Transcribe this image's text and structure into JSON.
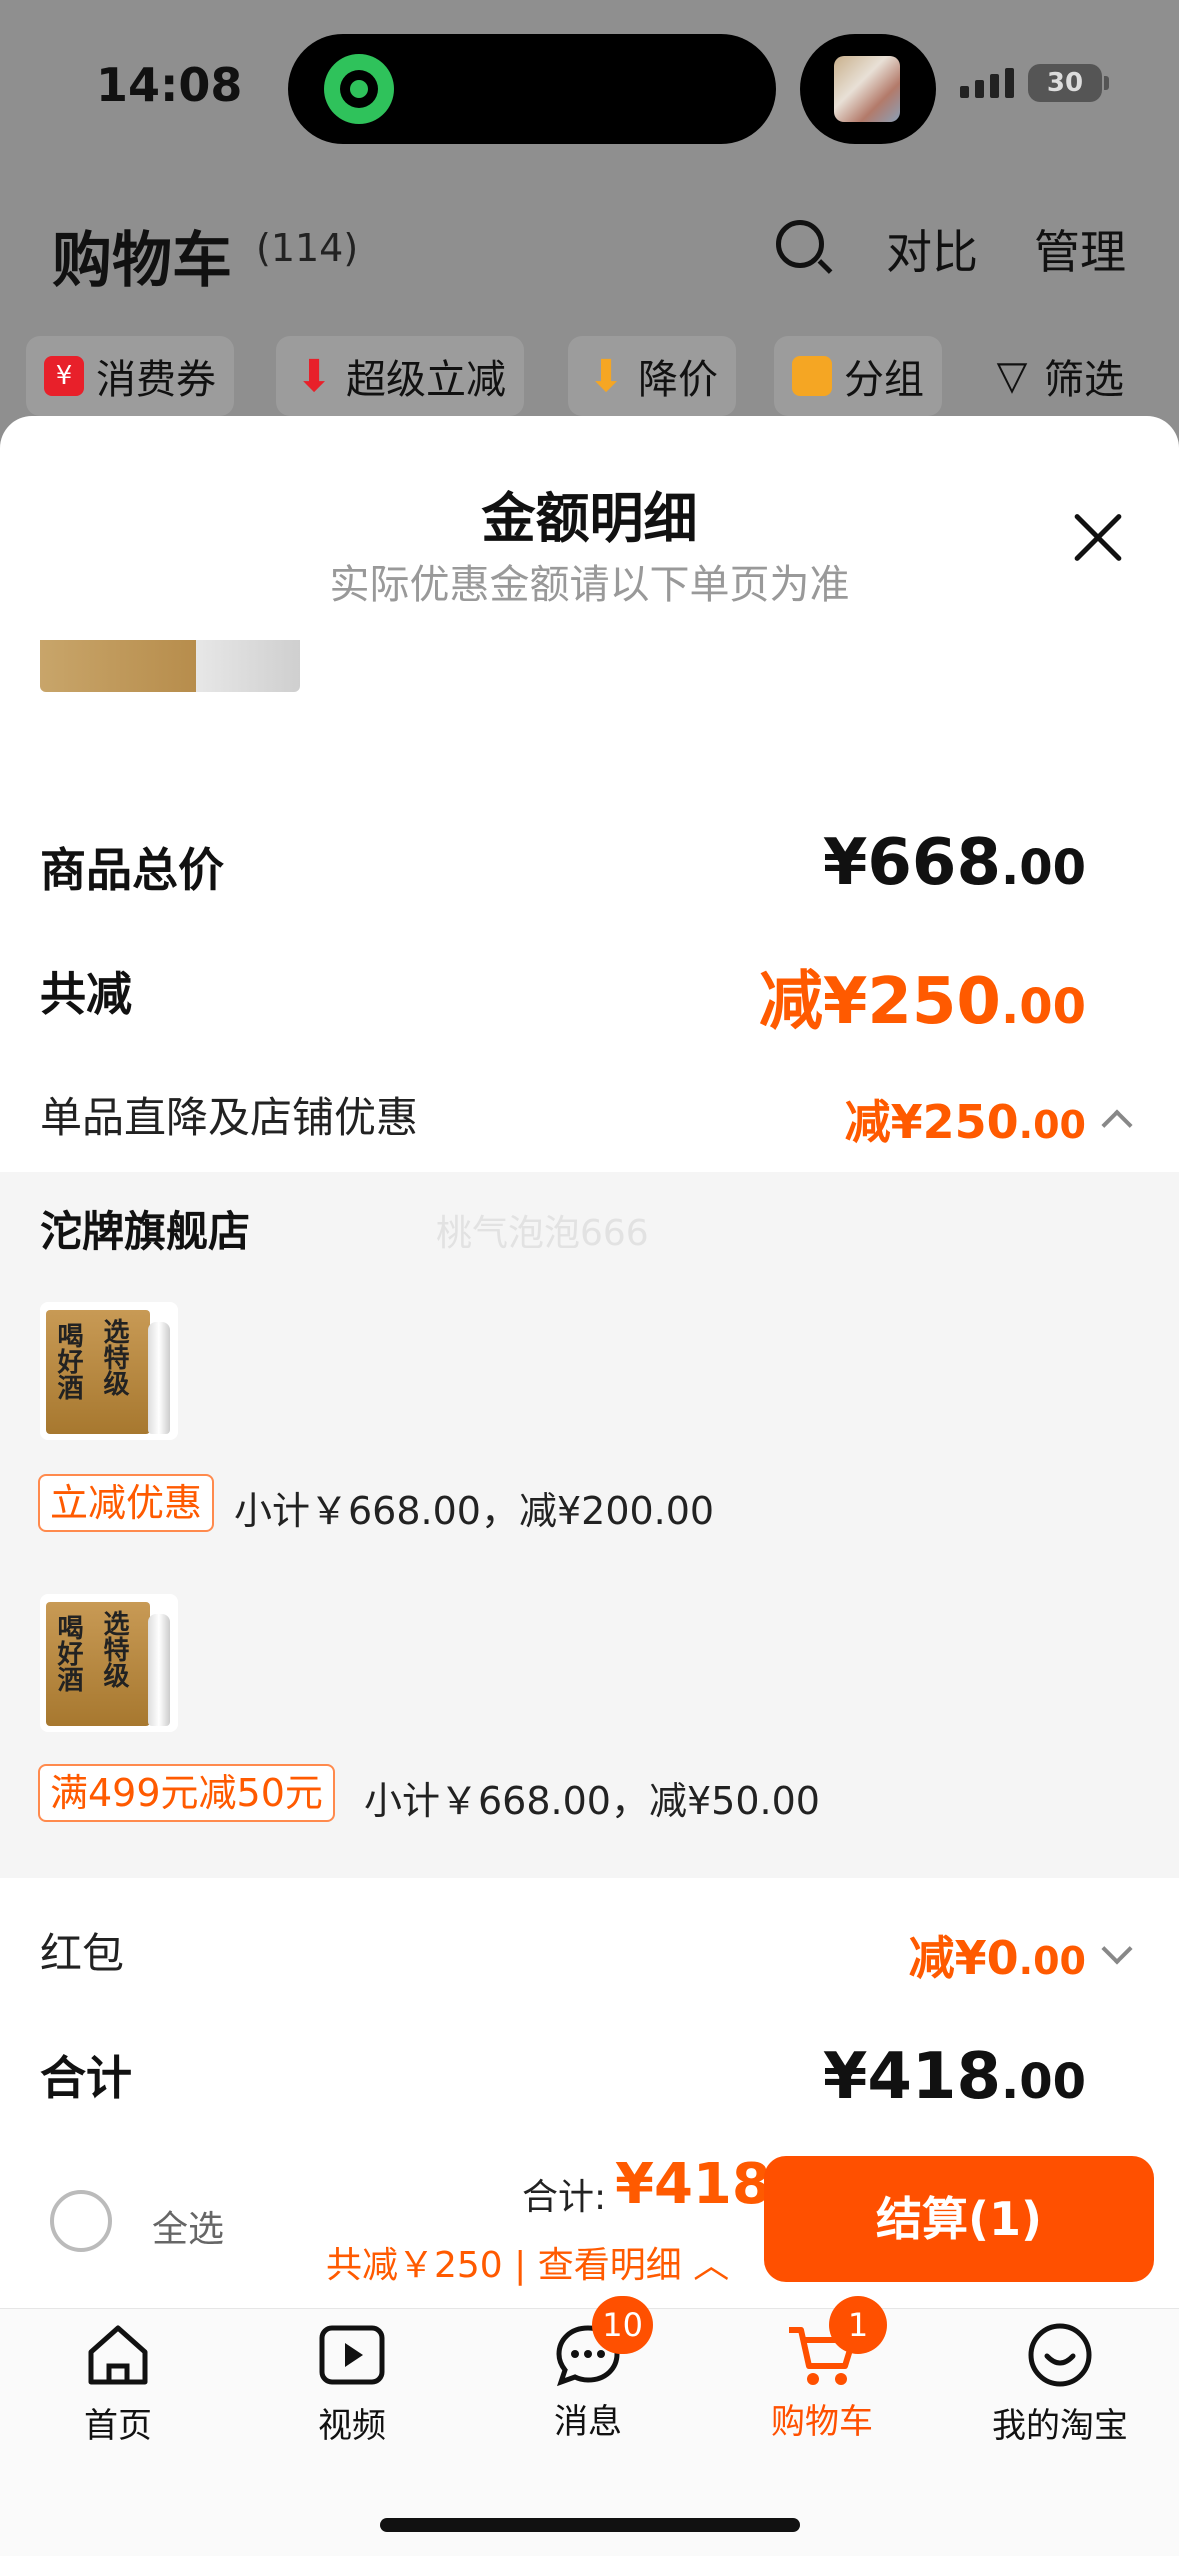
{
  "status_bar": {
    "time": "14:08",
    "battery": "30"
  },
  "header": {
    "title": "购物车",
    "count": "(114)",
    "compare": "对比",
    "manage": "管理"
  },
  "filters": [
    {
      "label": "消费券",
      "icon": "coupon-icon",
      "color": "#e8202a"
    },
    {
      "label": "超级立减",
      "icon": "arrow-down-icon",
      "color": "#e8202a"
    },
    {
      "label": "降价",
      "icon": "price-drop-icon",
      "color": "#f5a623"
    },
    {
      "label": "分组",
      "icon": "folder-icon",
      "color": "#f5a623"
    },
    {
      "label": "筛选",
      "icon": "filter-icon",
      "color": "#111111"
    }
  ],
  "sheet": {
    "title": "金额明细",
    "subtitle": "实际优惠金额请以下单页为准",
    "product_total_label": "商品总价",
    "product_total_value": "¥668",
    "product_total_cents": ".00",
    "total_reduce_label": "共减",
    "total_reduce_value": "减¥250",
    "total_reduce_cents": ".00",
    "item_discount_label": "单品直降及店铺优惠",
    "item_discount_value": "减¥250",
    "item_discount_cents": ".00",
    "store_name": "沱牌旗舰店",
    "watermark": "桃气泡泡666",
    "items": [
      {
        "tag": "立减优惠",
        "subtotal": "小计￥668.00，减¥200.00",
        "box_text_a": "喝好酒",
        "box_text_b": "选特级"
      },
      {
        "tag": "满499元减50元",
        "subtotal": "小计￥668.00，减¥50.00",
        "box_text_a": "喝好酒",
        "box_text_b": "选特级"
      }
    ],
    "red_packet_label": "红包",
    "red_packet_value": "减¥0",
    "red_packet_cents": ".00",
    "sum_label": "合计",
    "sum_value": "¥418",
    "sum_cents": ".00"
  },
  "bottom_bar": {
    "select_all": "全选",
    "total_label": "合计:",
    "total_value": "¥418",
    "discount_text": "共减￥250 | 查看明细",
    "checkout": "结算(1)"
  },
  "tabs": [
    {
      "label": "首页",
      "icon": "home-icon"
    },
    {
      "label": "视频",
      "icon": "video-icon"
    },
    {
      "label": "消息",
      "icon": "message-icon",
      "badge": "10"
    },
    {
      "label": "购物车",
      "icon": "cart-icon",
      "badge": "1",
      "active": true
    },
    {
      "label": "我的淘宝",
      "icon": "profile-icon"
    }
  ],
  "colors": {
    "accent": "#ff5000",
    "price": "#ff5a00",
    "overlay": "#8f8f8f"
  }
}
